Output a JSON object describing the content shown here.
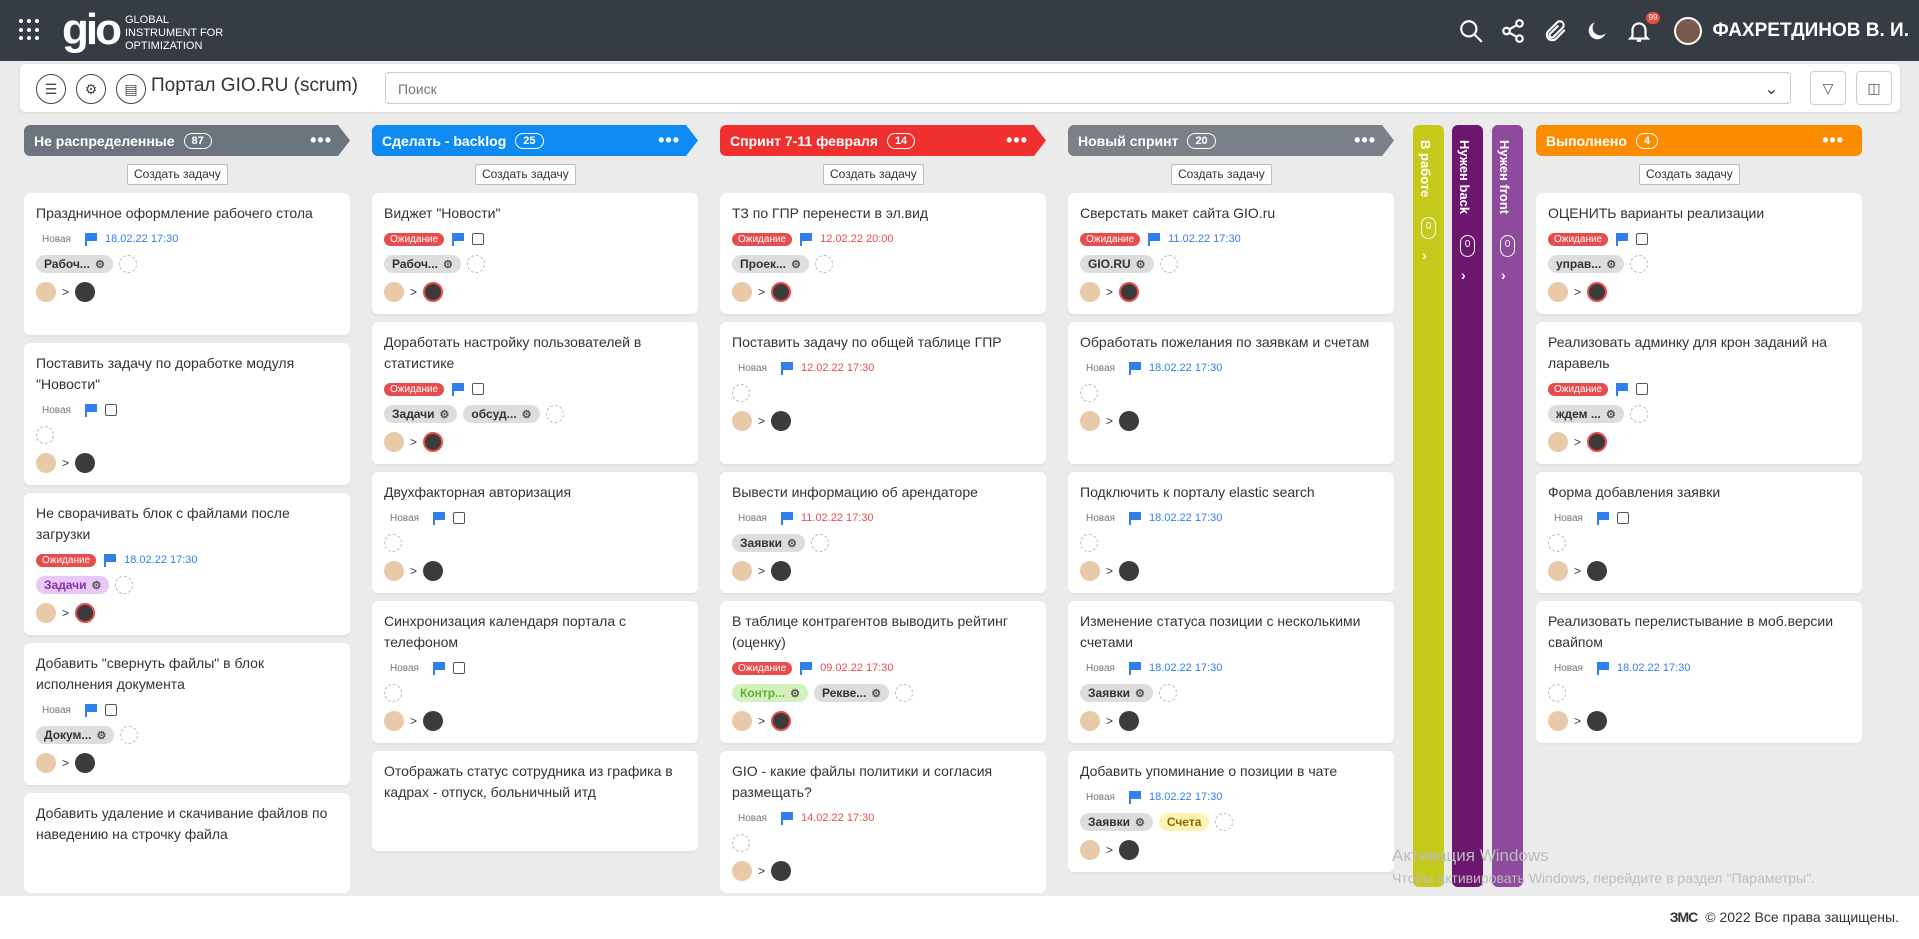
{
  "header": {
    "logo": "gio",
    "logo_sub": "GLOBAL INSTRUMENT FOR OPTIMIZATION",
    "notif_badge": "99",
    "user": "ФАХРЕТДИНОВ В. И."
  },
  "toolbar": {
    "title": "Портал GIO.RU (scrum)",
    "search_placeholder": "Поиск"
  },
  "create_label": "Создать задачу",
  "columns": [
    {
      "title": "Не распределенные",
      "count": "87",
      "color": "#6c757d",
      "cards": [
        {
          "title": "Праздничное оформление рабочего стола",
          "status": "Новая",
          "date": "18.02.22 17:30",
          "tags": [
            "Рабоч..."
          ]
        },
        {
          "title": "Поставить задачу по доработке модуля \"Новости\"",
          "status": "Новая"
        },
        {
          "title": "Не сворачивать блок с файлами после загрузки",
          "status": "Ожидание",
          "date": "18.02.22 17:30",
          "tags": [
            "Задачи"
          ]
        },
        {
          "title": "Добавить \"свернуть файлы\" в блок исполнения документа",
          "status": "Новая",
          "tags": [
            "Докум..."
          ]
        },
        {
          "title": "Добавить удаление и скачивание файлов по наведению на строчку файла"
        }
      ]
    },
    {
      "title": "Сделать - backlog",
      "count": "25",
      "color": "#0d8bf2",
      "cards": [
        {
          "title": "Виджет \"Новости\"",
          "status": "Ожидание",
          "tags": [
            "Рабоч..."
          ]
        },
        {
          "title": "Доработать настройку пользователей в статистике",
          "status": "Ожидание",
          "tags": [
            "Задачи",
            "обсуд..."
          ]
        },
        {
          "title": "Двухфакторная авторизация",
          "status": "Новая"
        },
        {
          "title": "Синхронизация календаря портала с телефоном",
          "status": "Новая"
        },
        {
          "title": "Отображать статус сотрудника из графика в кадрах - отпуск, больничный итд"
        }
      ]
    },
    {
      "title": "Спринт 7-11 февраля",
      "count": "14",
      "color": "#f0302f",
      "cards": [
        {
          "title": "ТЗ по ГПР перенести в эл.вид",
          "status": "Ожидание",
          "date": "12.02.22 20:00",
          "tags": [
            "Проек..."
          ]
        },
        {
          "title": "Поставить задачу по общей таблице ГПР",
          "status": "Новая",
          "date": "12.02.22 17:30"
        },
        {
          "title": "Вывести информацию об арендаторе",
          "status": "Новая",
          "date": "11.02.22 17:30",
          "tags": [
            "Заявки"
          ]
        },
        {
          "title": "В таблице контрагентов выводить рейтинг (оценку)",
          "status": "Ожидание",
          "date": "09.02.22 17:30",
          "tags": [
            "Контр...",
            "Рекве..."
          ]
        },
        {
          "title": "GIO - какие файлы политики и согласия размещать?",
          "status": "Новая",
          "date": "14.02.22 17:30"
        }
      ]
    },
    {
      "title": "Новый спринт",
      "count": "20",
      "color": "#7b8188",
      "cards": [
        {
          "title": "Сверстать макет сайта GIO.ru",
          "status": "Ожидание",
          "date": "11.02.22 17:30",
          "tags": [
            "GIO.RU"
          ]
        },
        {
          "title": "Обработать пожелания по заявкам и счетам",
          "status": "Новая",
          "date": "18.02.22 17:30"
        },
        {
          "title": "Подключить к порталу elastic search",
          "status": "Новая",
          "date": "18.02.22 17:30"
        },
        {
          "title": "Изменение статуса позиции с несколькими счетами",
          "status": "Новая",
          "date": "18.02.22 17:30",
          "tags": [
            "Заявки"
          ]
        },
        {
          "title": "Добавить упоминание о позиции в чате",
          "status": "Новая",
          "date": "18.02.22 17:30",
          "tags": [
            "Заявки",
            "Счета"
          ]
        }
      ]
    },
    {
      "title": "Выполнено",
      "count": "4",
      "color": "#fb8c00",
      "cards": [
        {
          "title": "ОЦЕНИТЬ варианты реализации",
          "status": "Ожидание",
          "tags": [
            "управ..."
          ]
        },
        {
          "title": "Реализовать админку для крон заданий на ларавель",
          "status": "Ожидание",
          "tags": [
            "ждем ..."
          ]
        },
        {
          "title": "Форма добавления заявки",
          "status": "Новая"
        },
        {
          "title": "Реализовать перелистывание в моб.версии свайпом",
          "status": "Новая",
          "date": "18.02.22 17:30"
        }
      ]
    }
  ],
  "vcols": [
    {
      "label": "В работе",
      "count": "0",
      "color": "#c5c91a"
    },
    {
      "label": "Нужен back",
      "count": "0",
      "color": "#6d1670"
    },
    {
      "label": "Нужен front",
      "count": "0",
      "color": "#8e4a9c"
    }
  ],
  "watermark": "Активация Windows",
  "watermark2": "Чтобы активировать Windows, перейдите в раздел \"Параметры\".",
  "footer": {
    "brand": "ЗМС",
    "copy": "© 2022 Все права защищены."
  }
}
